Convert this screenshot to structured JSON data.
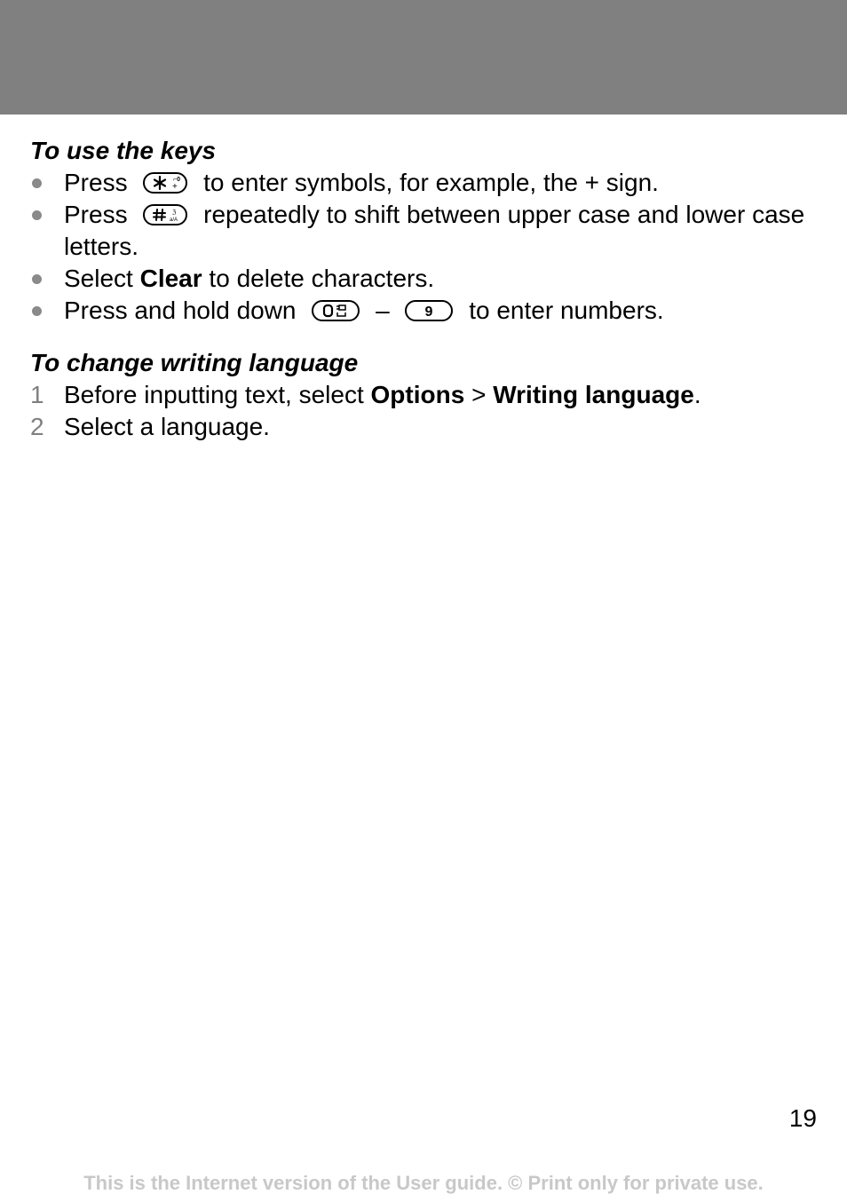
{
  "header": {
    "band_color": "#808080"
  },
  "section_keys": {
    "heading": "To use the keys",
    "items": [
      {
        "before": "Press",
        "key": "star-key",
        "after": "to enter symbols, for example, the + sign."
      },
      {
        "before": "Press",
        "key": "hash-key",
        "after": "repeatedly to shift between upper case and lower case letters."
      },
      {
        "before": "Select ",
        "bold": "Clear",
        "after": " to delete characters."
      },
      {
        "before": "Press and hold down",
        "key_from": "0-key",
        "separator": "–",
        "key_to": "9-key",
        "after": "to enter numbers."
      }
    ]
  },
  "section_language": {
    "heading": "To change writing language",
    "steps": [
      {
        "number": "1",
        "before": "Before inputting text, select ",
        "bold1": "Options",
        "sep": " > ",
        "bold2": "Writing language",
        "after": "."
      },
      {
        "number": "2",
        "text": "Select a language."
      }
    ]
  },
  "keys": {
    "star": {
      "main": "✱",
      "sub_top": "☎0",
      "sub_bottom": "+"
    },
    "hash": {
      "main": "#",
      "sub_top": "⇳",
      "sub_bottom": "a/A"
    },
    "zero": {
      "main": "0"
    },
    "nine": {
      "main": "9"
    }
  },
  "page_number": "19",
  "footer": "This is the Internet version of the User guide. © Print only for private use."
}
